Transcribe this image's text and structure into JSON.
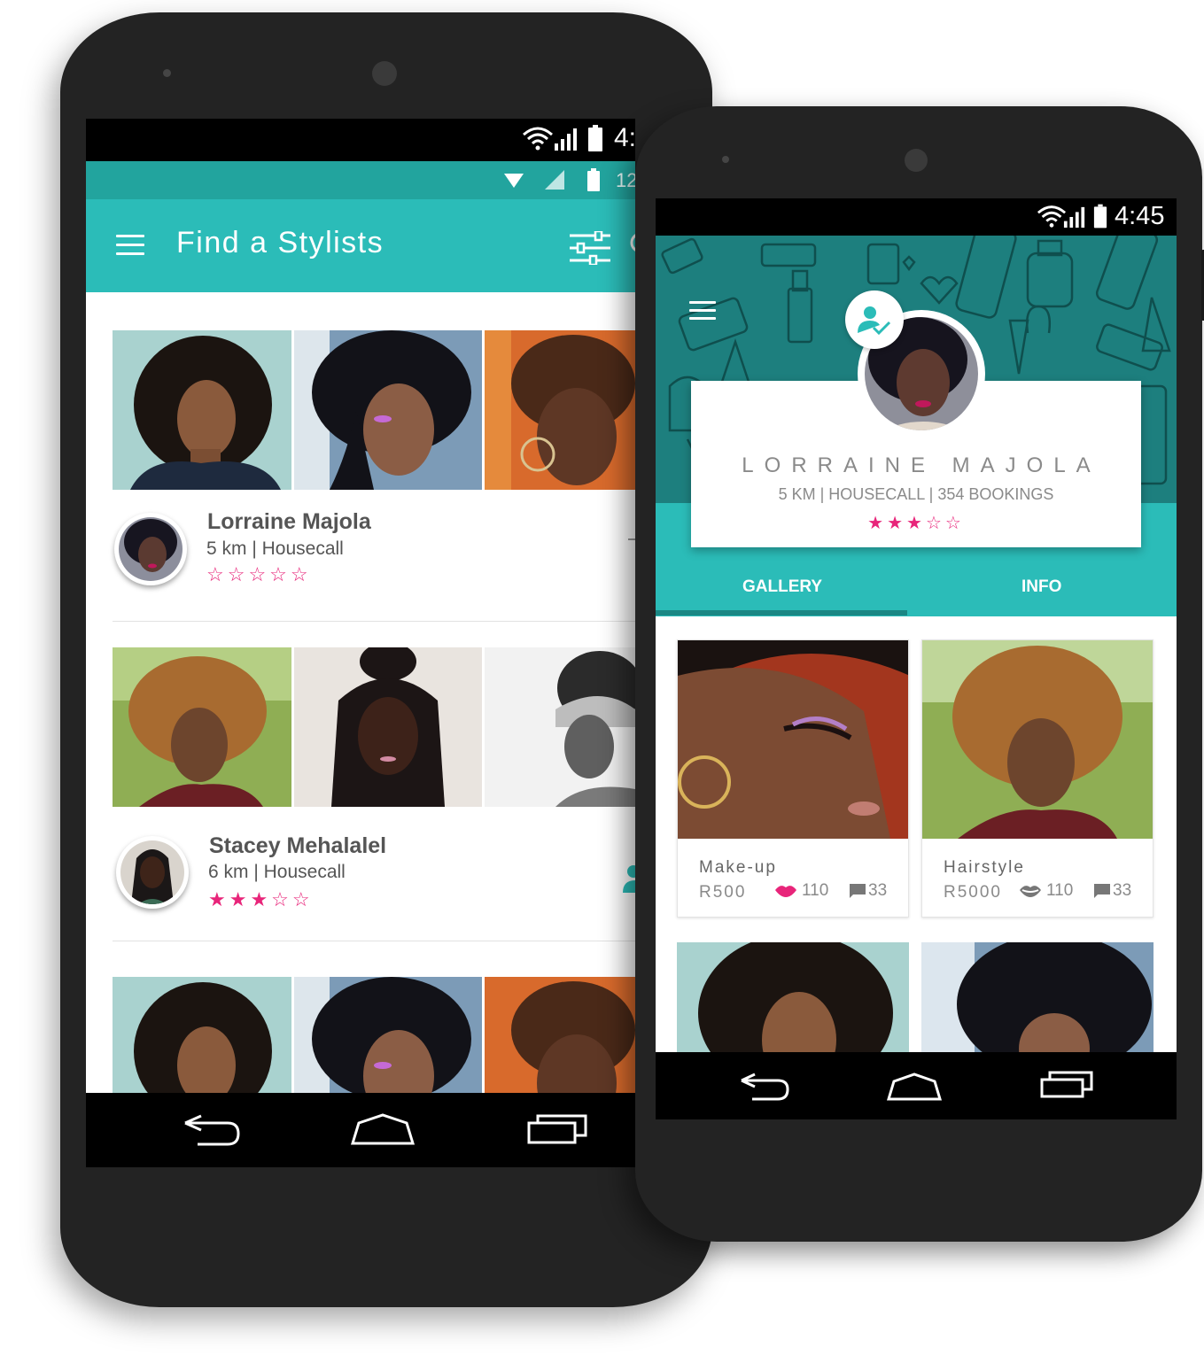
{
  "list_screen": {
    "status_time": "4:",
    "inner_status_time": "12",
    "app_title": "Find a Stylists",
    "stylists": [
      {
        "name": "Lorraine Majola",
        "meta": "5 km  | Housecall",
        "stars": "☆☆☆☆☆"
      },
      {
        "name": "Stacey Mehalalel",
        "meta": "6 km  | Housecall",
        "stars": "★★★☆☆"
      }
    ]
  },
  "profile_screen": {
    "status_time": "4:45",
    "name": "LORRAINE MAJOLA",
    "meta": "5 KM  |  HOUSECALL  |  354 BOOKINGS",
    "stars": "★★★☆☆",
    "tabs": [
      "GALLERY",
      "INFO"
    ],
    "gallery": [
      {
        "category": "Make-up",
        "price": "R500",
        "likes": "110",
        "comments": "33"
      },
      {
        "category": "Hairstyle",
        "price": "R5000",
        "likes": "110",
        "comments": "33"
      }
    ]
  },
  "colors": {
    "teal": "#2bbcb8",
    "dark_teal": "#1d7f7e",
    "pink": "#e8257a"
  },
  "icons": [
    "menu-icon",
    "filter-icon",
    "search-icon",
    "follow-icon",
    "heart-icon",
    "lips-icon",
    "comment-icon",
    "back-icon",
    "home-icon",
    "recents-icon",
    "wifi-icon",
    "signal-icon",
    "battery-icon"
  ]
}
